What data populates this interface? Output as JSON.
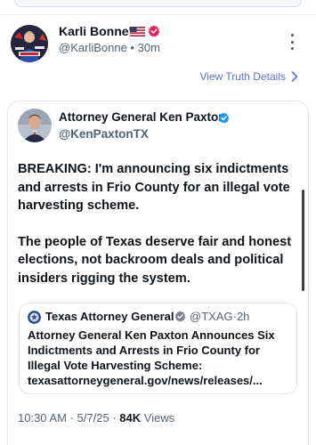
{
  "post": {
    "author_name": "Karli Bonne'",
    "handle": "@KarliBonne",
    "separator": "•",
    "age": "30m",
    "flag_icon": "us-flag-icon",
    "verified_icon": "pink-verified-badge-icon",
    "more_icon": "vertical-ellipsis-icon"
  },
  "view_truth": {
    "label": "View Truth Details",
    "icon": "chevron-right-icon"
  },
  "quoted": {
    "author_name": "Attorney General Ken Paxton",
    "handle": "@KenPaxtonTX",
    "verified_icon": "blue-verified-badge-icon",
    "paragraph1": "BREAKING: I'm announcing six indictments and arrests in Frio County for an illegal vote harvesting scheme.",
    "paragraph2": "The people of Texas deserve fair and honest elections, not backroom deals and political insiders rigging the system.",
    "embedded": {
      "author_name": "Texas Attorney General",
      "verified_icon": "grey-verified-badge-icon",
      "handle": "@TXAG",
      "separator": "·",
      "age": "2h",
      "lines": [
        "Attorney General Ken Paxton Announces Six",
        "Indictments and Arrests in Frio County for",
        "Illegal Vote Harvesting Scheme:",
        "texasattorneygeneral.gov/news/releases/..."
      ]
    },
    "footer": {
      "time": "10:30 AM",
      "date": "5/7/25",
      "separator": "·",
      "views_count": "84K",
      "views_label": "Views"
    }
  },
  "colors": {
    "link": "#5a73d8",
    "verified_pink": "#e0245e",
    "verified_blue": "#1d9bf0",
    "muted_text": "#536471"
  }
}
